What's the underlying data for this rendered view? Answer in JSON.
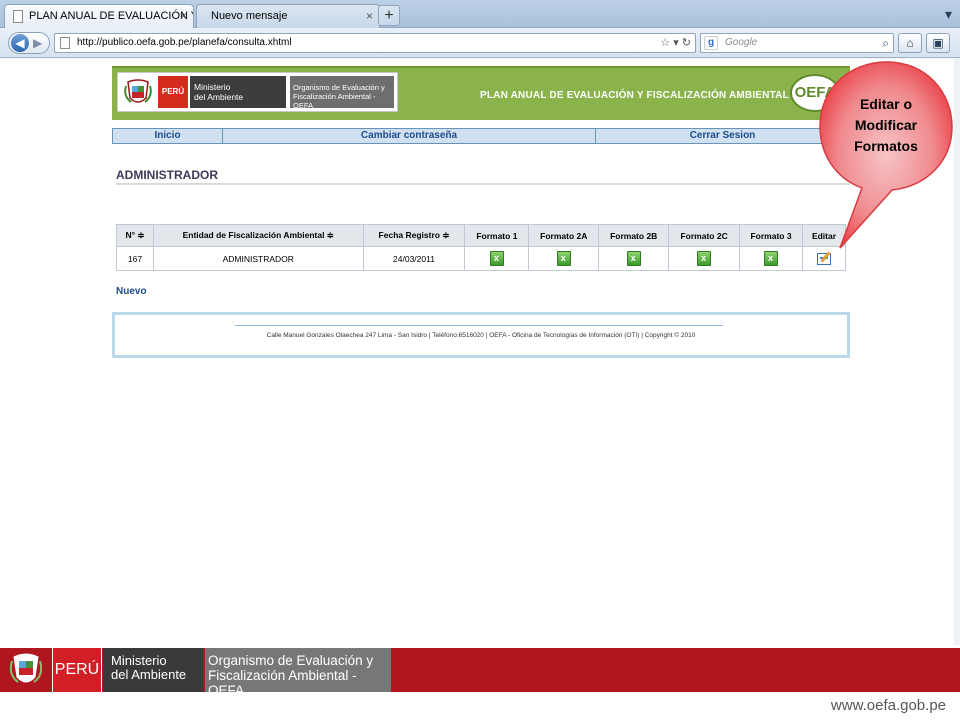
{
  "browser": {
    "tabs": [
      {
        "label": "PLAN ANUAL DE EVALUACIÓN Y FIS...",
        "close": "×"
      },
      {
        "label": "Nuevo mensaje",
        "close": "×"
      }
    ],
    "new_tab": "+",
    "url": "http://publico.oefa.gob.pe/planefa/consulta.xhtml",
    "search_placeholder": "Google"
  },
  "header": {
    "peru": "PERÚ",
    "ministerio": "Ministerio\ndel Ambiente",
    "organismo": "Organismo de Evaluación y\nFiscalización Ambiental - OEFA",
    "title": "PLAN ANUAL DE EVALUACIÓN Y FISCALIZACIÓN AMBIENTAL",
    "logo": "OEFA"
  },
  "menu": {
    "inicio": "Inicio",
    "cambiar": "Cambiar contraseña",
    "cerrar": "Cerrar Sesion"
  },
  "page_title": "ADMINISTRADOR",
  "table": {
    "headers": [
      "N° ≑",
      "Entidad de Fiscalización Ambiental ≑",
      "Fecha Registro ≑",
      "Formato 1",
      "Formato 2A",
      "Formato 2B",
      "Formato 2C",
      "Formato 3",
      "Editar"
    ],
    "row": {
      "n": "167",
      "entidad": "ADMINISTRADOR",
      "fecha": "24/03/2011"
    }
  },
  "nuevo": "Nuevo",
  "footer": "Calle Manuel Gonzales Olaechea 247 Lima - San Isidro | Teléfono:6516020 | OEFA - Oficina de Tecnologías de Información (OTI) | Copyright © 2010",
  "callout": "Editar o\nModificar\nFormatos",
  "banner": {
    "peru": "PERÚ",
    "ministerio": "Ministerio\ndel Ambiente",
    "organismo": "Organismo de Evaluación y\nFiscalización Ambiental -OEFA",
    "url": "www.oefa.gob.pe"
  },
  "colors": {
    "header_green": "#8bb34b",
    "menu_blue": "#cfe1f1",
    "link_blue": "#1e4b8a",
    "callout_red": "#e8383e",
    "banner_red": "#b0161d"
  }
}
